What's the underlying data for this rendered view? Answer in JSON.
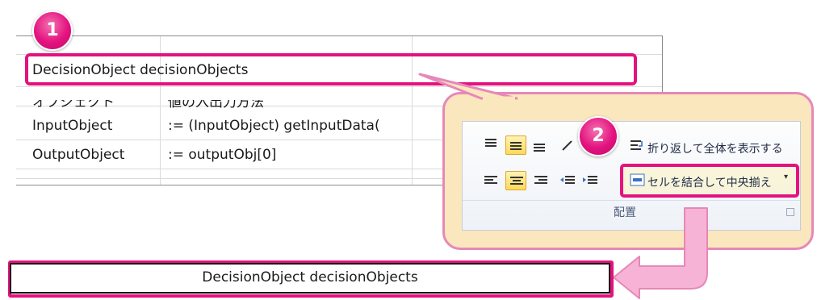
{
  "markers": {
    "step1": "1",
    "step2": "2"
  },
  "sheet": {
    "header_cell": "DecisionObject decisionObjects",
    "rows": [
      {
        "col_a": "オブジェクト",
        "col_b": "値の入出力方法"
      },
      {
        "col_a": "InputObject",
        "col_b": ":= (InputObject) getInputData("
      },
      {
        "col_a": "OutputObject",
        "col_b": ":= outputObj[0]"
      }
    ]
  },
  "ribbon": {
    "wrap_text_label": "折り返して全体を表示する",
    "merge_center_label": "セルを結合して中央揃え",
    "group_label": "配置"
  },
  "result": {
    "merged_text": "DecisionObject decisionObjects"
  },
  "colors": {
    "highlight": "#e3127f",
    "callout_fill": "#fbe7bd",
    "arrow_fill": "#f6b3d6"
  }
}
